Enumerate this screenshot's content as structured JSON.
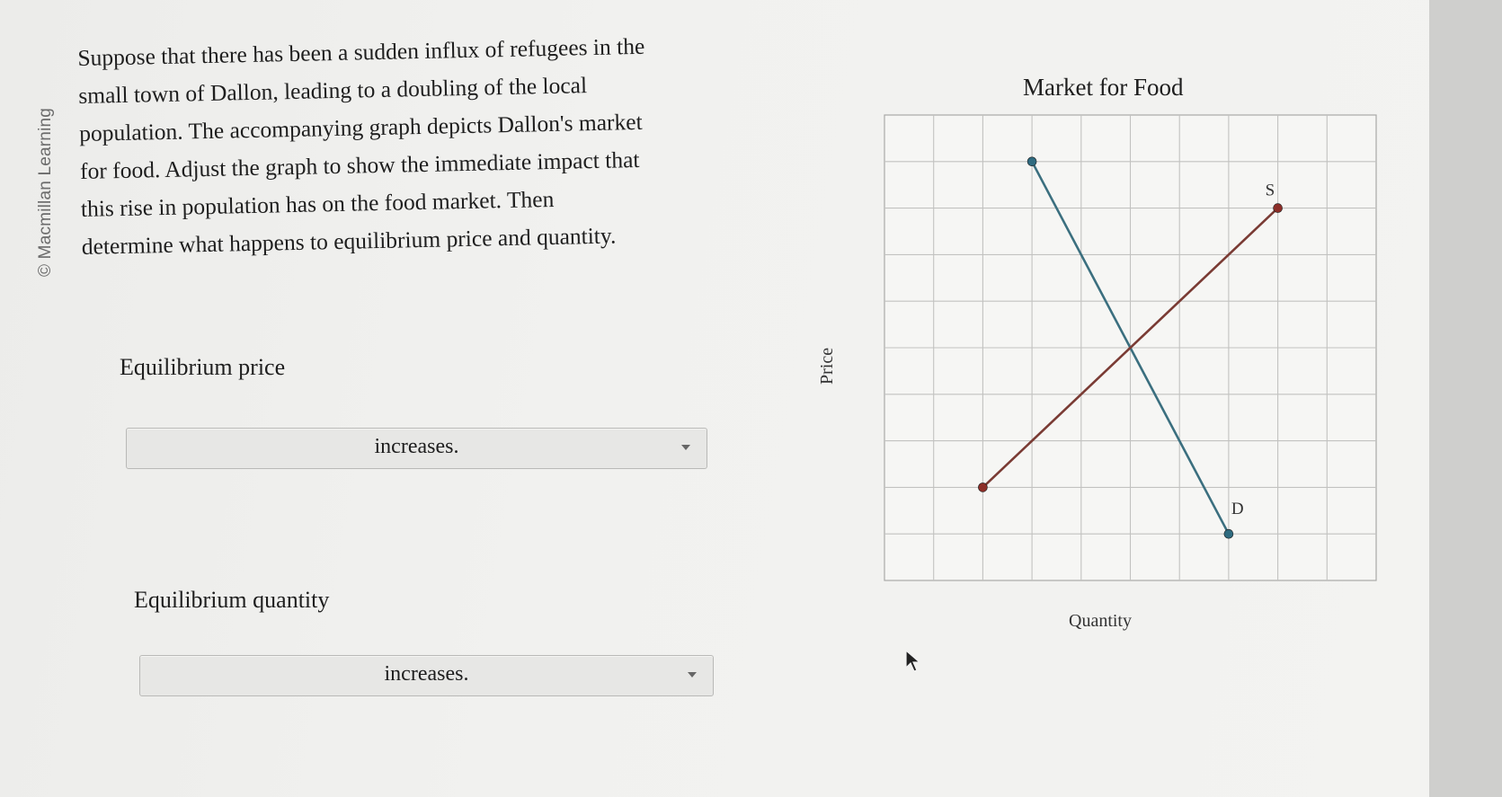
{
  "watermark": "© Macmillan Learning",
  "question": {
    "lines": [
      "Suppose that there has been a sudden influx of refugees in the",
      "small town of Dallon, leading to a doubling of the local",
      "population. The accompanying graph depicts Dallon's market",
      "for food. Adjust the graph to show the immediate impact that",
      "this rise in population has on the food market. Then",
      "determine what happens to equilibrium price and quantity."
    ]
  },
  "equilibrium_price": {
    "label": "Equilibrium price",
    "selected": "increases."
  },
  "equilibrium_quantity": {
    "label": "Equilibrium quantity",
    "selected": "increases."
  },
  "chart_data": {
    "type": "line",
    "title": "Market for Food",
    "xlabel": "Quantity",
    "ylabel": "Price",
    "xlim": [
      0,
      10
    ],
    "ylim": [
      0,
      10
    ],
    "grid": true,
    "tick_labels_shown": false,
    "series": [
      {
        "name": "D",
        "color": "#3b6f7f",
        "points": [
          [
            3,
            9
          ],
          [
            7,
            1
          ]
        ]
      },
      {
        "name": "S",
        "color": "#7a3b34",
        "points": [
          [
            2,
            2
          ],
          [
            8,
            8
          ]
        ]
      }
    ],
    "endpoint_colors": {
      "D": "#2f6b80",
      "S": "#8c2e28"
    }
  }
}
